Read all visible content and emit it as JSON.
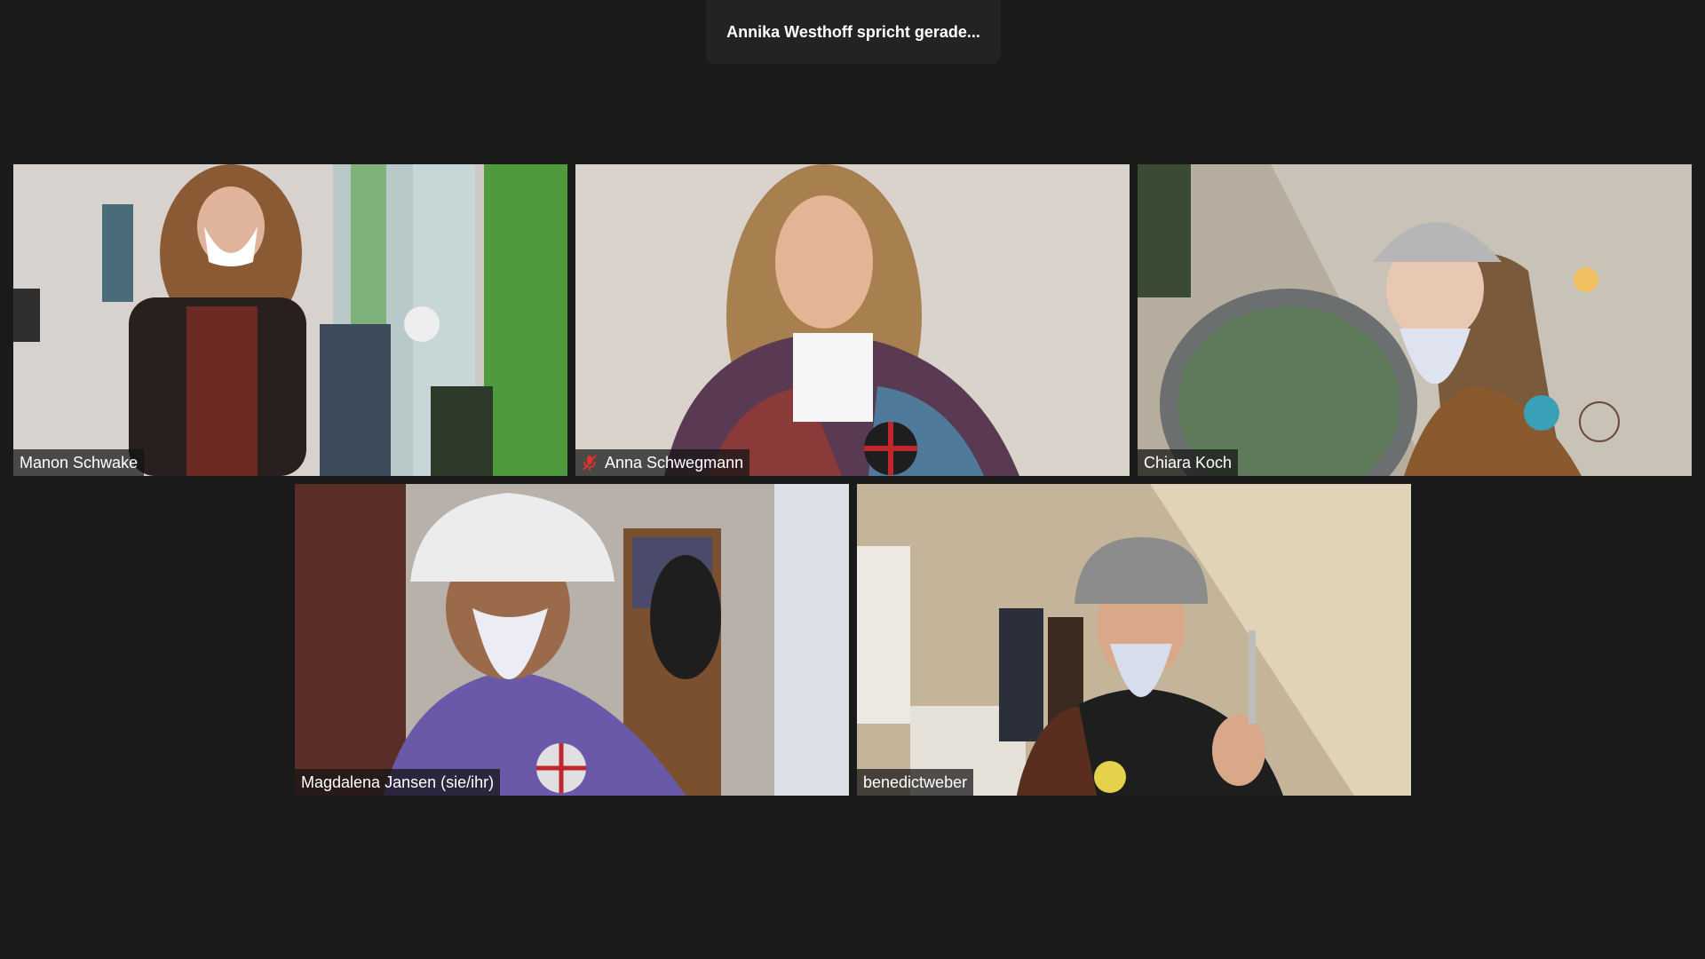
{
  "speaker_banner": {
    "text": "Annika Westhoff spricht gerade..."
  },
  "participants": [
    {
      "name": "Manon Schwake",
      "muted": false
    },
    {
      "name": "Anna Schwegmann",
      "muted": true,
      "mute_icon": "microphone-muted-icon"
    },
    {
      "name": "Chiara Koch",
      "muted": false
    },
    {
      "name": "Magdalena Jansen (sie/ihr)",
      "muted": false
    },
    {
      "name": "benedictweber",
      "muted": false
    }
  ],
  "colors": {
    "background": "#1a1a1a",
    "banner": "#232323",
    "mute_red": "#e0332b"
  }
}
